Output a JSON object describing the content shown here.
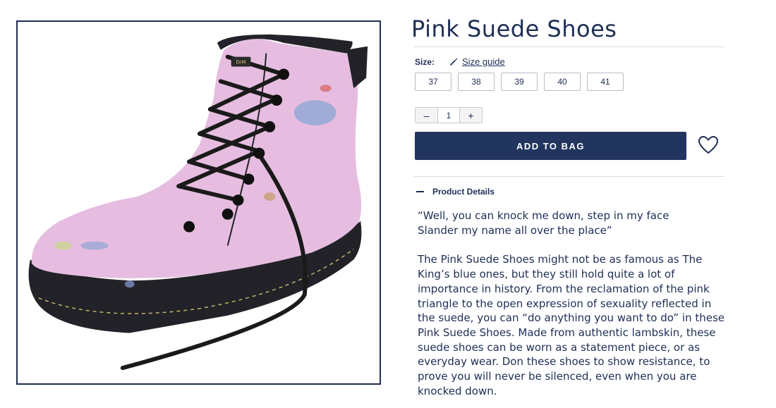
{
  "product": {
    "title": "Pink Suede Shoes",
    "image_alt": "Pink suede lace-up boot illustration"
  },
  "size": {
    "label": "Size:",
    "guide_label": "Size guide",
    "options": [
      "37",
      "38",
      "39",
      "40",
      "41"
    ]
  },
  "quantity": {
    "minus": "–",
    "value": "1",
    "plus": "+"
  },
  "actions": {
    "add_to_bag": "ADD TO BAG",
    "wishlist_icon": "heart-icon"
  },
  "details": {
    "toggle_icon": "minus-icon",
    "title": "Product Details",
    "quote": "“Well, you can knock me down, step in my face\nSlander my name all over the place”",
    "description": "The Pink Suede Shoes might not be as famous as The King’s blue ones, but they still hold quite a lot of importance in history. From the reclamation of the pink triangle to the open expression of sexuality reflected in the suede, you can “do anything you want to do” in these Pink Suede Shoes. Made from authentic lambskin, these suede shoes can be worn as a statement piece, or as everyday wear. Don these shoes to show resistance, to prove you will never be silenced, even when you are knocked down."
  },
  "colors": {
    "navy": "#1f2e55",
    "button": "#22355f",
    "boot_pink": "#e6bde0",
    "sole": "#222228"
  }
}
